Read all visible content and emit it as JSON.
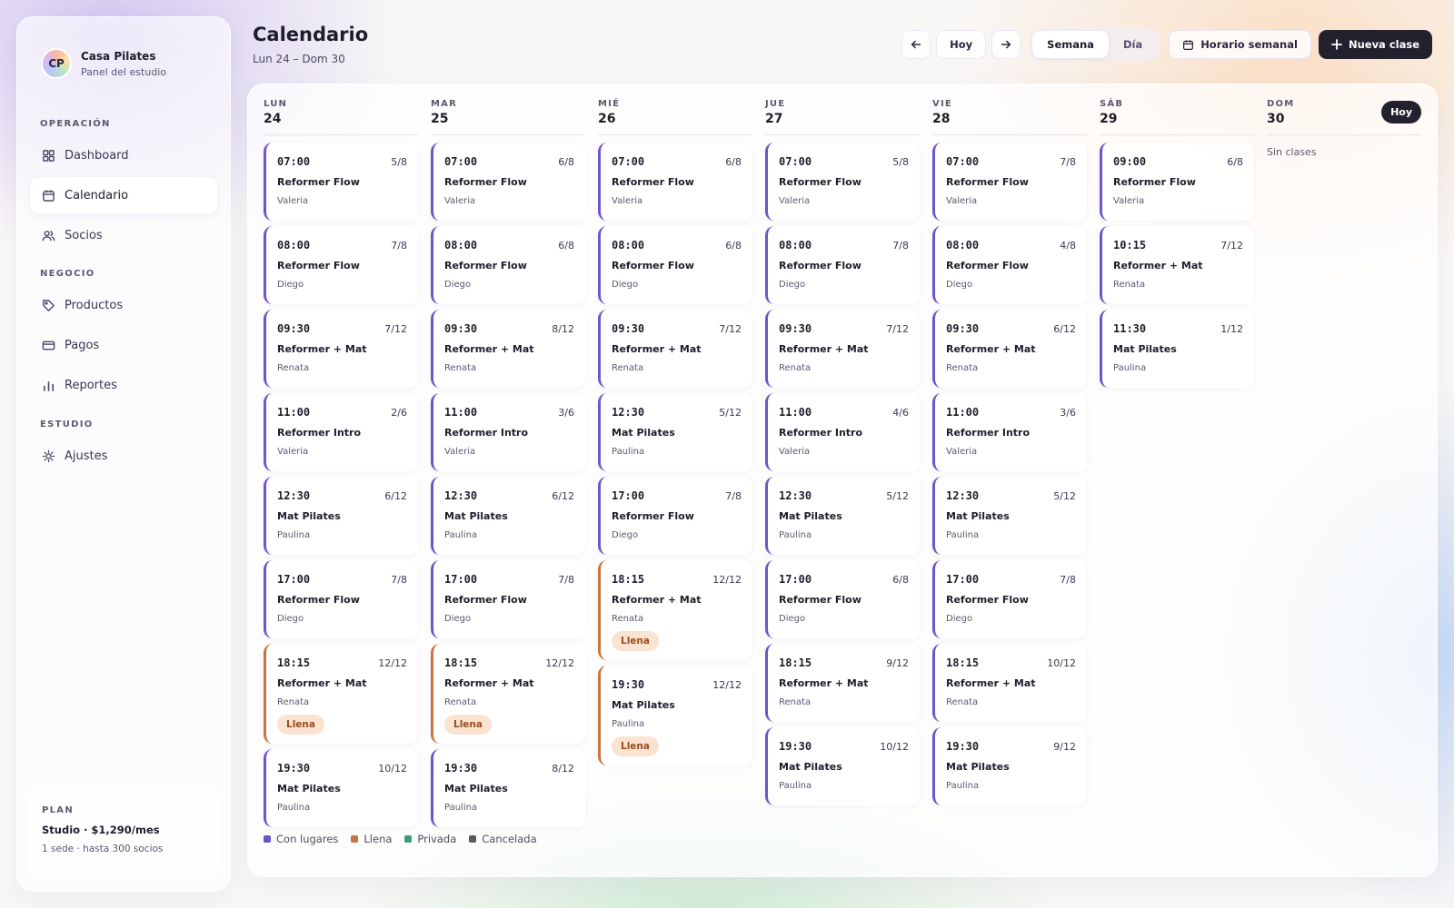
{
  "brand": {
    "initials": "CP",
    "name": "Casa Pilates",
    "subtitle": "Panel del estudio"
  },
  "sidebar": {
    "sections": [
      {
        "label": "OPERACIÓN",
        "items": [
          {
            "label": "Dashboard",
            "icon": "grid-icon",
            "active": false
          },
          {
            "label": "Calendario",
            "icon": "calendar-icon",
            "active": true
          },
          {
            "label": "Socios",
            "icon": "users-icon",
            "active": false
          }
        ]
      },
      {
        "label": "NEGOCIO",
        "items": [
          {
            "label": "Productos",
            "icon": "tag-icon",
            "active": false
          },
          {
            "label": "Pagos",
            "icon": "card-icon",
            "active": false
          },
          {
            "label": "Reportes",
            "icon": "bar-chart-icon",
            "active": false
          }
        ]
      },
      {
        "label": "ESTUDIO",
        "items": [
          {
            "label": "Ajustes",
            "icon": "sun-gear-icon",
            "active": false
          }
        ]
      }
    ],
    "plan": {
      "label": "PLAN",
      "name": "Studio · $1,290/mes",
      "desc": "1 sede · hasta 300 socios"
    }
  },
  "header": {
    "title": "Calendario",
    "range": "Lun 24 – Dom 30"
  },
  "toolbar": {
    "today_label": "Hoy",
    "view_week": "Semana",
    "view_day": "Día",
    "active_view": "Semana",
    "schedule_label": "Horario semanal",
    "new_class_label": "Nueva clase"
  },
  "calendar": {
    "today_badge": "Hoy",
    "days": [
      {
        "name": "LUN",
        "num": "24",
        "classes": [
          {
            "time": "07:00",
            "count": "5/8",
            "name": "Reformer Flow",
            "teacher": "Valeria",
            "status": "open"
          },
          {
            "time": "08:00",
            "count": "7/8",
            "name": "Reformer Flow",
            "teacher": "Diego",
            "status": "open"
          },
          {
            "time": "09:30",
            "count": "7/12",
            "name": "Reformer + Mat",
            "teacher": "Renata",
            "status": "open"
          },
          {
            "time": "11:00",
            "count": "2/6",
            "name": "Reformer Intro",
            "teacher": "Valeria",
            "status": "open"
          },
          {
            "time": "12:30",
            "count": "6/12",
            "name": "Mat Pilates",
            "teacher": "Paulina",
            "status": "open"
          },
          {
            "time": "17:00",
            "count": "7/8",
            "name": "Reformer Flow",
            "teacher": "Diego",
            "status": "open"
          },
          {
            "time": "18:15",
            "count": "12/12",
            "name": "Reformer + Mat",
            "teacher": "Renata",
            "status": "full"
          },
          {
            "time": "19:30",
            "count": "10/12",
            "name": "Mat Pilates",
            "teacher": "Paulina",
            "status": "open"
          }
        ]
      },
      {
        "name": "MAR",
        "num": "25",
        "classes": [
          {
            "time": "07:00",
            "count": "6/8",
            "name": "Reformer Flow",
            "teacher": "Valeria",
            "status": "open"
          },
          {
            "time": "08:00",
            "count": "6/8",
            "name": "Reformer Flow",
            "teacher": "Diego",
            "status": "open"
          },
          {
            "time": "09:30",
            "count": "8/12",
            "name": "Reformer + Mat",
            "teacher": "Renata",
            "status": "open"
          },
          {
            "time": "11:00",
            "count": "3/6",
            "name": "Reformer Intro",
            "teacher": "Valeria",
            "status": "open"
          },
          {
            "time": "12:30",
            "count": "6/12",
            "name": "Mat Pilates",
            "teacher": "Paulina",
            "status": "open"
          },
          {
            "time": "17:00",
            "count": "7/8",
            "name": "Reformer Flow",
            "teacher": "Diego",
            "status": "open"
          },
          {
            "time": "18:15",
            "count": "12/12",
            "name": "Reformer + Mat",
            "teacher": "Renata",
            "status": "full"
          },
          {
            "time": "19:30",
            "count": "8/12",
            "name": "Mat Pilates",
            "teacher": "Paulina",
            "status": "open"
          }
        ]
      },
      {
        "name": "MIÉ",
        "num": "26",
        "classes": [
          {
            "time": "07:00",
            "count": "6/8",
            "name": "Reformer Flow",
            "teacher": "Valeria",
            "status": "open"
          },
          {
            "time": "08:00",
            "count": "6/8",
            "name": "Reformer Flow",
            "teacher": "Diego",
            "status": "open"
          },
          {
            "time": "09:30",
            "count": "7/12",
            "name": "Reformer + Mat",
            "teacher": "Renata",
            "status": "open"
          },
          {
            "time": "12:30",
            "count": "5/12",
            "name": "Mat Pilates",
            "teacher": "Paulina",
            "status": "open"
          },
          {
            "time": "17:00",
            "count": "7/8",
            "name": "Reformer Flow",
            "teacher": "Diego",
            "status": "open"
          },
          {
            "time": "18:15",
            "count": "12/12",
            "name": "Reformer + Mat",
            "teacher": "Renata",
            "status": "full"
          },
          {
            "time": "19:30",
            "count": "12/12",
            "name": "Mat Pilates",
            "teacher": "Paulina",
            "status": "full"
          }
        ]
      },
      {
        "name": "JUE",
        "num": "27",
        "classes": [
          {
            "time": "07:00",
            "count": "5/8",
            "name": "Reformer Flow",
            "teacher": "Valeria",
            "status": "open"
          },
          {
            "time": "08:00",
            "count": "7/8",
            "name": "Reformer Flow",
            "teacher": "Diego",
            "status": "open"
          },
          {
            "time": "09:30",
            "count": "7/12",
            "name": "Reformer + Mat",
            "teacher": "Renata",
            "status": "open"
          },
          {
            "time": "11:00",
            "count": "4/6",
            "name": "Reformer Intro",
            "teacher": "Valeria",
            "status": "open"
          },
          {
            "time": "12:30",
            "count": "5/12",
            "name": "Mat Pilates",
            "teacher": "Paulina",
            "status": "open"
          },
          {
            "time": "17:00",
            "count": "6/8",
            "name": "Reformer Flow",
            "teacher": "Diego",
            "status": "open"
          },
          {
            "time": "18:15",
            "count": "9/12",
            "name": "Reformer + Mat",
            "teacher": "Renata",
            "status": "open"
          },
          {
            "time": "19:30",
            "count": "10/12",
            "name": "Mat Pilates",
            "teacher": "Paulina",
            "status": "open"
          }
        ]
      },
      {
        "name": "VIE",
        "num": "28",
        "classes": [
          {
            "time": "07:00",
            "count": "7/8",
            "name": "Reformer Flow",
            "teacher": "Valeria",
            "status": "open"
          },
          {
            "time": "08:00",
            "count": "4/8",
            "name": "Reformer Flow",
            "teacher": "Diego",
            "status": "open"
          },
          {
            "time": "09:30",
            "count": "6/12",
            "name": "Reformer + Mat",
            "teacher": "Renata",
            "status": "open"
          },
          {
            "time": "11:00",
            "count": "3/6",
            "name": "Reformer Intro",
            "teacher": "Valeria",
            "status": "open"
          },
          {
            "time": "12:30",
            "count": "5/12",
            "name": "Mat Pilates",
            "teacher": "Paulina",
            "status": "open"
          },
          {
            "time": "17:00",
            "count": "7/8",
            "name": "Reformer Flow",
            "teacher": "Diego",
            "status": "open"
          },
          {
            "time": "18:15",
            "count": "10/12",
            "name": "Reformer + Mat",
            "teacher": "Renata",
            "status": "open"
          },
          {
            "time": "19:30",
            "count": "9/12",
            "name": "Mat Pilates",
            "teacher": "Paulina",
            "status": "open"
          }
        ]
      },
      {
        "name": "SÁB",
        "num": "29",
        "classes": [
          {
            "time": "09:00",
            "count": "6/8",
            "name": "Reformer Flow",
            "teacher": "Valeria",
            "status": "open"
          },
          {
            "time": "10:15",
            "count": "7/12",
            "name": "Reformer + Mat",
            "teacher": "Renata",
            "status": "open"
          },
          {
            "time": "11:30",
            "count": "1/12",
            "name": "Mat Pilates",
            "teacher": "Paulina",
            "status": "open"
          }
        ]
      },
      {
        "name": "DOM",
        "num": "30",
        "today": true,
        "empty_note": "Sin clases",
        "classes": []
      }
    ],
    "full_label": "Llena",
    "legend": [
      {
        "label": "Con lugares",
        "color": "#6f55c7"
      },
      {
        "label": "Llena",
        "color": "#c7743e"
      },
      {
        "label": "Privada",
        "color": "#3f9a72"
      },
      {
        "label": "Cancelada",
        "color": "#5a5866"
      }
    ]
  }
}
